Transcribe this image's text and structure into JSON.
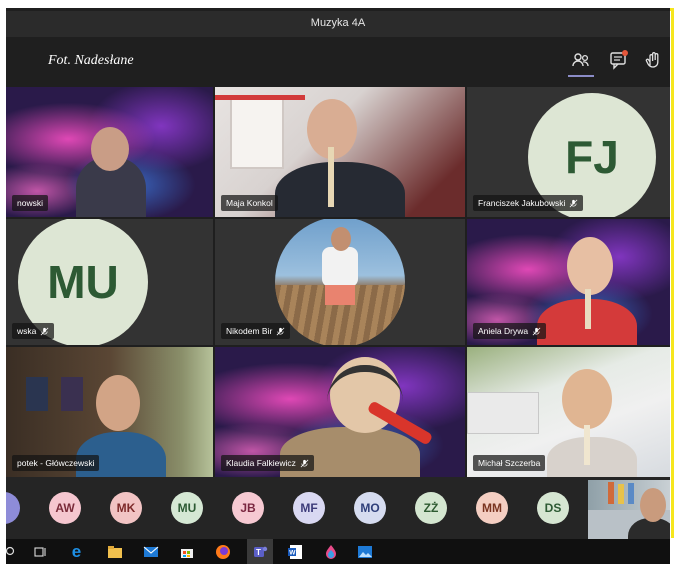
{
  "window": {
    "title": "Muzyka 4A"
  },
  "meeting": {
    "watermark": "Fot. Nadesłane",
    "toolbar_icons": [
      "participants-icon",
      "chat-icon",
      "raise-hand-icon"
    ]
  },
  "tiles": [
    {
      "name": "nowski",
      "kind": "video",
      "mic_muted": false
    },
    {
      "name": "Maja Konkol",
      "kind": "video",
      "mic_muted": false
    },
    {
      "name": "Franciszek Jakubowski",
      "kind": "avatar",
      "initials": "FJ",
      "mic_muted": true
    },
    {
      "name": "wska",
      "kind": "avatar",
      "initials": "MU",
      "mic_muted": true
    },
    {
      "name": "Nikodem Bir",
      "kind": "photo",
      "mic_muted": true
    },
    {
      "name": "Aniela Drywa",
      "kind": "video",
      "mic_muted": true
    },
    {
      "name": "potek - Główczewski",
      "kind": "video",
      "mic_muted": false
    },
    {
      "name": "Klaudia Falkiewicz",
      "kind": "video",
      "mic_muted": true
    },
    {
      "name": "Michał Szczerba",
      "kind": "video",
      "mic_muted": false
    }
  ],
  "participants_strip": [
    {
      "initials": "",
      "bg": "#8e8cd8",
      "fg": "#2d2b6b"
    },
    {
      "initials": "AW",
      "bg": "#f5c6cf",
      "fg": "#7a2b3a"
    },
    {
      "initials": "MK",
      "bg": "#f2c4c4",
      "fg": "#7d2a2a"
    },
    {
      "initials": "MU",
      "bg": "#d5e8d4",
      "fg": "#2d5a34"
    },
    {
      "initials": "JB",
      "bg": "#f6c9d2",
      "fg": "#7a2740"
    },
    {
      "initials": "MF",
      "bg": "#d9d8f2",
      "fg": "#3d3b7a"
    },
    {
      "initials": "MO",
      "bg": "#d6dcf0",
      "fg": "#2f3f7a"
    },
    {
      "initials": "ZŻ",
      "bg": "#d4e6d0",
      "fg": "#2d5a30"
    },
    {
      "initials": "MM",
      "bg": "#f4cec2",
      "fg": "#7a3420"
    },
    {
      "initials": "DS",
      "bg": "#d6e6d2",
      "fg": "#2d5a34"
    }
  ],
  "taskbar": {
    "icons": [
      "search-icon",
      "task-view-icon",
      "edge-icon",
      "file-explorer-icon",
      "mail-icon",
      "store-icon",
      "firefox-icon",
      "teams-icon",
      "word-icon",
      "paint3d-icon",
      "photos-icon"
    ]
  }
}
